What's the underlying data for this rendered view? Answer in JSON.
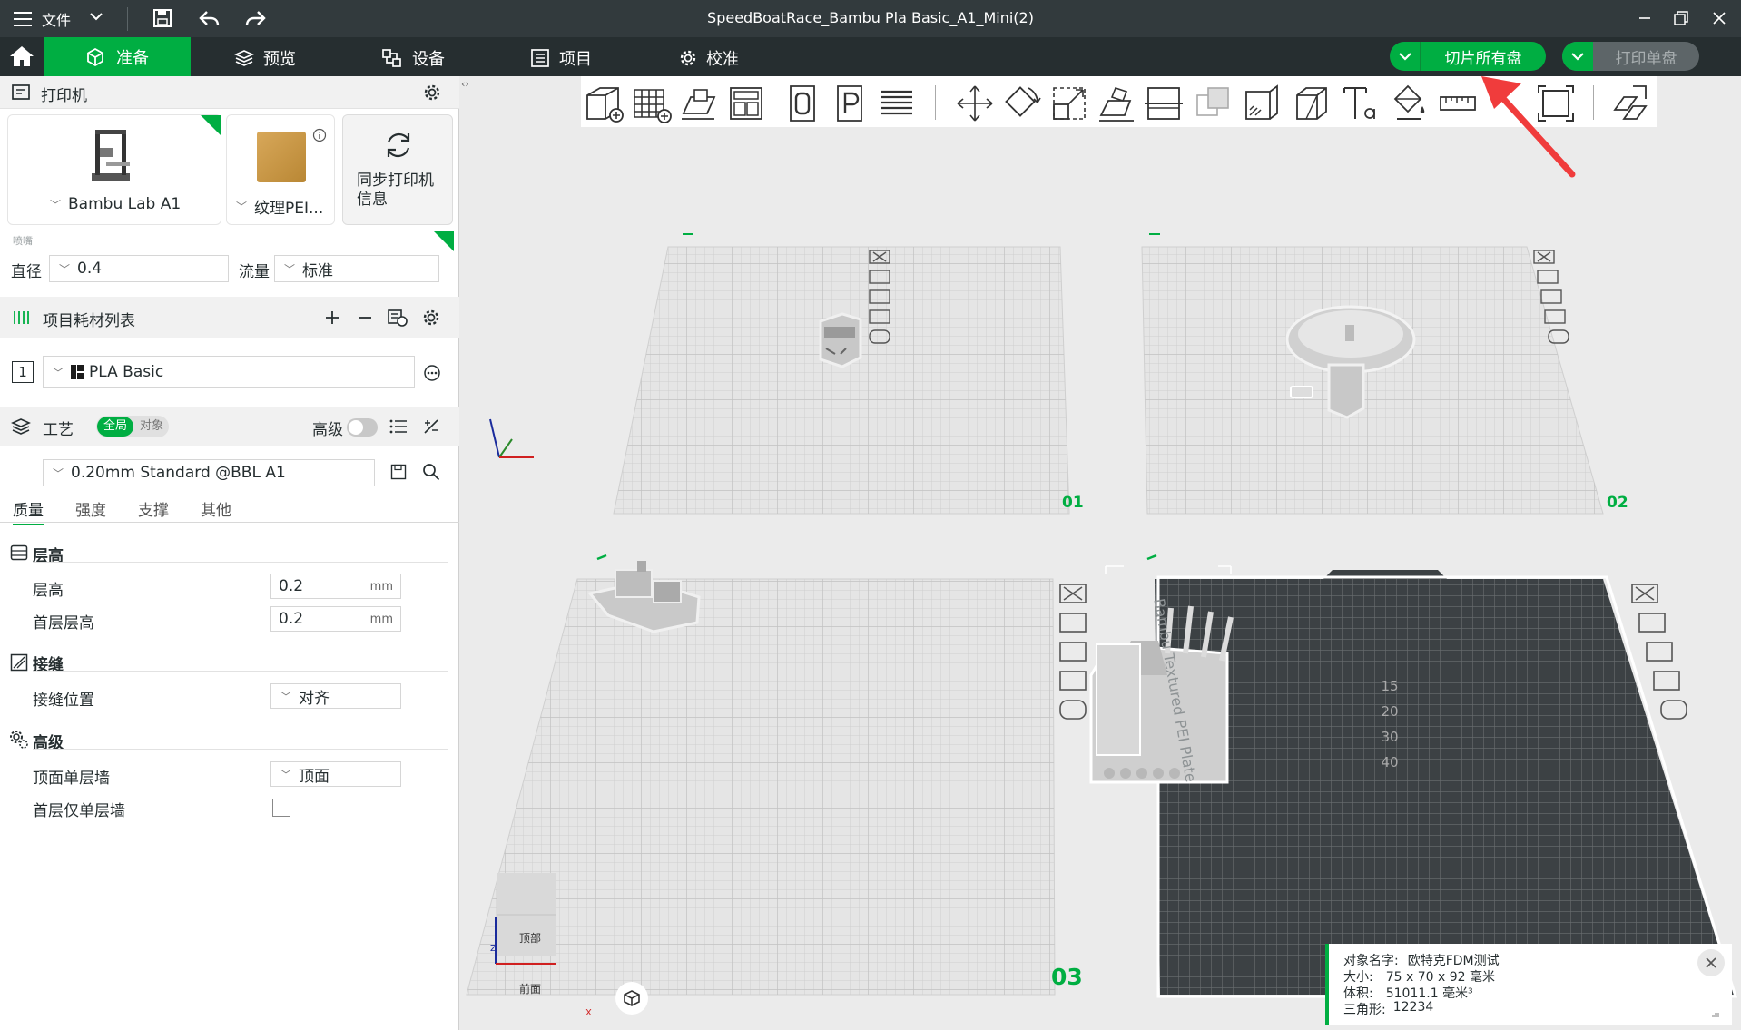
{
  "titlebar": {
    "file_label": "文件",
    "title": "SpeedBoatRace_Bambu Pla Basic_A1_Mini(2)"
  },
  "menubar": {
    "tabs": [
      {
        "label": "准备"
      },
      {
        "label": "预览"
      },
      {
        "label": "设备"
      },
      {
        "label": "项目"
      },
      {
        "label": "校准"
      }
    ],
    "slice_all_label": "切片所有盘",
    "print_plate_label": "打印单盘",
    "accent": "#00ae42"
  },
  "printer": {
    "section_title": "打印机",
    "printer_name": "Bambu Lab A1",
    "plate_name": "纹理PEI...",
    "sync_label": "同步打印机信息",
    "nozzle_title": "喷嘴",
    "diameter_label": "直径",
    "diameter_value": "0.4",
    "flow_label": "流量",
    "flow_value": "标准"
  },
  "filament": {
    "section_title": "项目耗材列表",
    "items": [
      {
        "index": "1",
        "name": "PLA Basic"
      }
    ]
  },
  "process": {
    "section_title": "工艺",
    "toggle_global": "全局",
    "toggle_object": "对象",
    "advanced_label": "高级",
    "preset": "0.20mm Standard @BBL A1",
    "tabs": [
      "质量",
      "强度",
      "支撑",
      "其他"
    ],
    "groups": {
      "layer": {
        "title": "层高",
        "rows": [
          {
            "label": "层高",
            "value": "0.2",
            "unit": "mm"
          },
          {
            "label": "首层层高",
            "value": "0.2",
            "unit": "mm"
          }
        ]
      },
      "seam": {
        "title": "接缝",
        "rows": [
          {
            "label": "接缝位置",
            "value": "对齐"
          }
        ]
      },
      "advanced": {
        "title": "高级",
        "rows": [
          {
            "label": "顶面单层墙",
            "value": "顶面"
          },
          {
            "label": "首层仅单层墙",
            "value": ""
          }
        ]
      }
    }
  },
  "viewport": {
    "plates": [
      {
        "number": "01"
      },
      {
        "number": "02"
      },
      {
        "number": "03"
      },
      {
        "number": ""
      }
    ],
    "plate_bed_text": "Bambu Textured PEI Plate",
    "calib_numbers": [
      "15",
      "20",
      "30",
      "40"
    ],
    "cube_top": "顶部",
    "cube_front": "前面",
    "axis_z": "Z",
    "axis_x": "X"
  },
  "object_info": {
    "name_label": "对象名字:",
    "name_value": "欧特克FDM测试",
    "size_label": "大小:",
    "size_value": "75 x 70 x 92 毫米",
    "volume_label": "体积:",
    "volume_value": "51011.1 毫米³",
    "triangles_label": "三角形:",
    "triangles_value": "12234"
  }
}
